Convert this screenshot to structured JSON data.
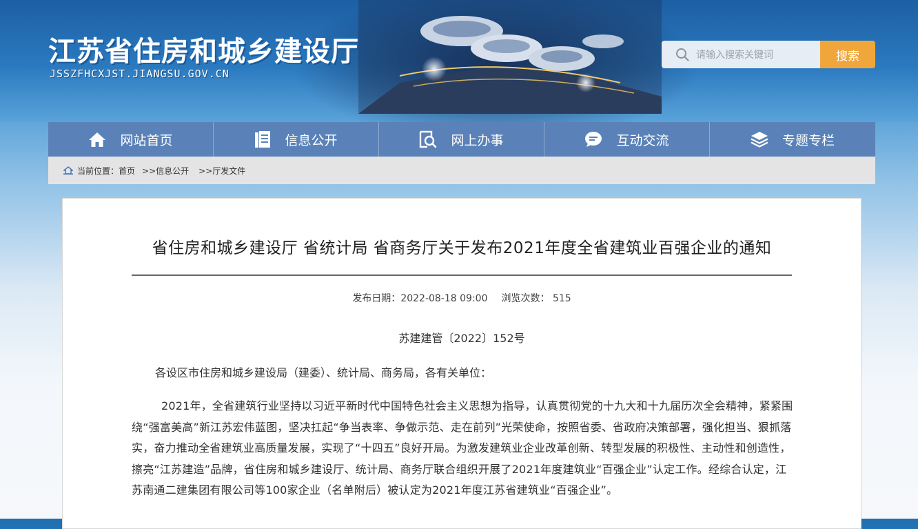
{
  "header": {
    "site_title": "江苏省住房和城乡建设厅",
    "site_domain": "JSSZFHCXJST.JIANGSU.GOV.CN",
    "search_placeholder": "请输入搜索关键词",
    "search_button": "搜索"
  },
  "nav": {
    "items": [
      {
        "label": "网站首页",
        "icon": "home-icon"
      },
      {
        "label": "信息公开",
        "icon": "document-icon"
      },
      {
        "label": "网上办事",
        "icon": "search-doc-icon"
      },
      {
        "label": "互动交流",
        "icon": "chat-icon"
      },
      {
        "label": "专题专栏",
        "icon": "layers-icon"
      }
    ]
  },
  "breadcrumb": {
    "prefix": "当前位置：",
    "items": [
      "首页",
      ">>信息公开",
      ">>厅发文件"
    ]
  },
  "article": {
    "title": "省住房和城乡建设厅 省统计局 省商务厅关于发布2021年度全省建筑业百强企业的通知",
    "publish_label": "发布日期：",
    "publish_date": "2022-08-18 09:00",
    "views_label": "浏览次数：",
    "views": "515",
    "doc_number": "苏建建管〔2022〕152号",
    "salutation": "各设区市住房和城乡建设局（建委）、统计局、商务局，各有关单位：",
    "paragraph": "2021年，全省建筑行业坚持以习近平新时代中国特色社会主义思想为指导，认真贯彻党的十九大和十九届历次全会精神，紧紧围绕“强富美高”新江苏宏伟蓝图，坚决扛起“争当表率、争做示范、走在前列”光荣使命，按照省委、省政府决策部署，强化担当、狠抓落实，奋力推动全省建筑业高质量发展，实现了“十四五”良好开局。为激发建筑业企业改革创新、转型发展的积极性、主动性和创造性，擦亮“江苏建造”品牌，省住房和城乡建设厅、统计局、商务厅联合组织开展了2021年度建筑业“百强企业”认定工作。经综合认定，江苏南通二建集团有限公司等100家企业（名单附后）被认定为2021年度江苏省建筑业“百强企业”。"
  },
  "colors": {
    "nav_bg": "#5a82b8",
    "search_button": "#f0a63a",
    "breadcrumb_bg": "#e4e4e4"
  }
}
